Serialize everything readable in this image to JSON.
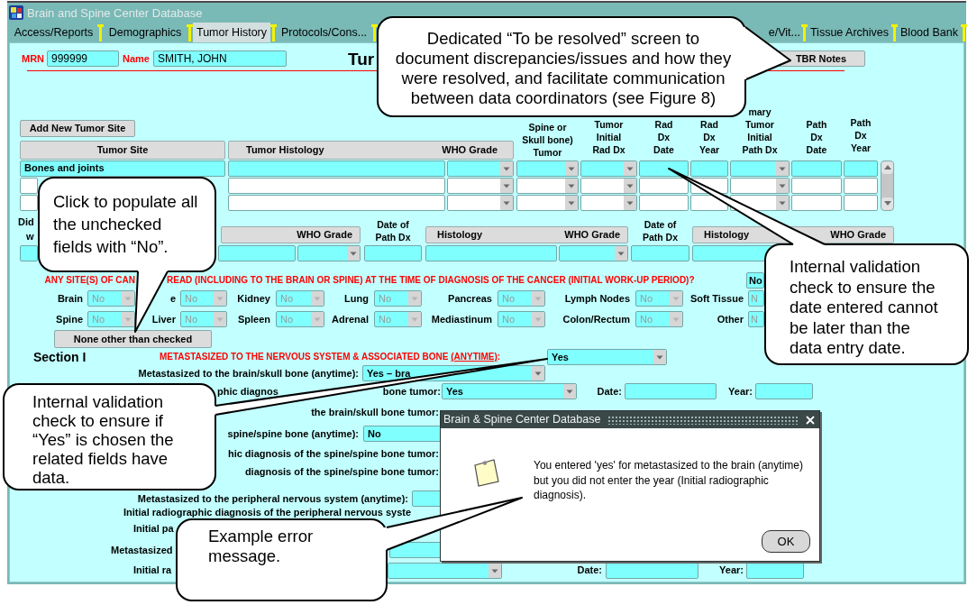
{
  "window": {
    "title": "Brain and Spine Center Database"
  },
  "tabs": [
    {
      "label": "Access/Reports",
      "selected": false
    },
    {
      "label": "Demographics",
      "selected": false
    },
    {
      "label": "Tumor History",
      "selected": true
    },
    {
      "label": "Protocols/Cons...",
      "selected": false
    },
    {
      "label": "e/Vit...",
      "selected": false
    },
    {
      "label": "Tissue Archives",
      "selected": false
    },
    {
      "label": "Blood Bank",
      "selected": false
    }
  ],
  "patient": {
    "mrn_label": "MRN",
    "mrn": "999999",
    "name_label": "Name",
    "name": "SMITH, JOHN"
  },
  "page_title": "Tur",
  "tbr_button": "TBR Notes",
  "tumor_table": {
    "add_button": "Add New Tumor Site",
    "header_boxes": [
      [
        "Tumor Site"
      ],
      [
        "Tumor Histology",
        "WHO Grade"
      ]
    ],
    "column_headers": [
      "Spine or\nSkull bone)\nTumor",
      "Tumor\nInitial\nRad Dx",
      "Rad\nDx\nDate",
      "Rad\nDx\nYear",
      "mary\nTumor\nInitial\nPath Dx",
      "Path\nDx\nDate",
      "Path\nDx\nYear"
    ],
    "columns": [
      {
        "kind": "text"
      },
      {
        "kind": "text"
      },
      {
        "kind": "select"
      },
      {
        "kind": "select"
      },
      {
        "kind": "select"
      },
      {
        "kind": "text"
      },
      {
        "kind": "text"
      },
      {
        "kind": "select"
      },
      {
        "kind": "text"
      },
      {
        "kind": "text"
      }
    ],
    "rows": [
      {
        "selected": true,
        "tumor_site": "Bones and joints"
      },
      {
        "selected": false
      },
      {
        "selected": false
      }
    ]
  },
  "pathology": {
    "label_fragments": [
      "Did",
      "w"
    ],
    "header_groups": [
      {
        "labels": [
          "WHO Grade"
        ],
        "date_label": "Date of\nPath Dx"
      },
      {
        "labels": [
          "Histology",
          "WHO Grade"
        ],
        "date_label": "Date of\nPath Dx"
      },
      {
        "labels": [
          "Histology",
          "WHO Grade"
        ]
      }
    ],
    "fields": [
      {
        "kind": "text"
      },
      {
        "kind": "text"
      },
      {
        "kind": "select"
      },
      {
        "kind": "text"
      },
      {
        "kind": "text"
      },
      {
        "kind": "select"
      },
      {
        "kind": "text"
      },
      {
        "kind": "text"
      }
    ]
  },
  "spread_question": {
    "parts": [
      "ANY SITE(S) OF CAN",
      "READ (INCLUDING TO THE BRAIN OR SPINE) AT THE TIME OF DIAGNOSIS OF THE CANCER (INITIAL WORK-UP PERIOD)?"
    ],
    "answer": "No"
  },
  "sites": [
    [
      {
        "label": "Brain",
        "value": "No",
        "disabled": true
      },
      {
        "label": "e",
        "value": "No",
        "disabled": true
      },
      {
        "label": "Kidney",
        "value": "No",
        "disabled": true
      },
      {
        "label": "Lung",
        "value": "No",
        "disabled": true
      },
      {
        "label": "Pancreas",
        "value": "No",
        "disabled": true
      },
      {
        "label": "Lymph Nodes",
        "value": "No",
        "disabled": true
      },
      {
        "label": "Soft Tissue",
        "value": "N",
        "disabled": true
      }
    ],
    [
      {
        "label": "Spine",
        "value": "No",
        "disabled": true
      },
      {
        "label": "Liver",
        "value": "No",
        "disabled": true
      },
      {
        "label": "Spleen",
        "value": "No",
        "disabled": true
      },
      {
        "label": "Adrenal",
        "value": "No",
        "disabled": true
      },
      {
        "label": "Mediastinum",
        "value": "No",
        "disabled": true
      },
      {
        "label": "Colon/Rectum",
        "value": "No",
        "disabled": true
      },
      {
        "label": "Other",
        "value": "N",
        "disabled": true
      }
    ]
  ],
  "none_button": "None other than checked",
  "section_1": {
    "label": "Section I",
    "heading": {
      "before": "METASTASIZED TO THE NERVOUS SYSTEM & ASSOCIATED BONE ",
      "underlined": "(ANYTIME)",
      "after": ":"
    },
    "answer": "Yes",
    "rows": [
      {
        "label_parts": [
          "Metastasized to the brain/skull bone (anytime):"
        ],
        "field": {
          "kind": "select",
          "value": "Yes – bra"
        }
      },
      {
        "label_parts": [
          "phic diagnos",
          "bone tumor:"
        ],
        "field": {
          "kind": "select",
          "value": "Yes"
        },
        "date_label": "Date:",
        "year_label": "Year:"
      },
      {
        "label_parts": [
          "the brain/skull bone tumor:"
        ]
      },
      {
        "label_parts": [
          "spine/spine bone (anytime):"
        ],
        "field": {
          "kind": "select",
          "value": "No"
        }
      },
      {
        "label_parts": [
          "hic diagnosis of the spine/spine bone tumor:"
        ]
      },
      {
        "label_parts": [
          "diagnosis of the spine/spine bone tumor:"
        ]
      },
      {
        "label_parts": [
          "Metastasized to the peripheral nervous system (anytime):"
        ],
        "field": {
          "kind": "text"
        }
      },
      {
        "label_parts": [
          "Initial radiographic diagnosis of the peripheral nervous syste"
        ]
      },
      {
        "label_parts": [
          "Initial pa"
        ]
      },
      {
        "label_parts": [
          "Metastasized"
        ],
        "field": {
          "kind": "text"
        }
      },
      {
        "label_parts": [
          "Initial ra"
        ],
        "field": {
          "kind": "select"
        },
        "date_label": "Date:",
        "year_label": "Year:"
      }
    ]
  },
  "dialog": {
    "title": "Brain & Spine Center Database",
    "message": "You entered 'yes' for metastasized to the brain (anytime) but you did not enter the year (Initial radiographic diagnosis).",
    "ok_button": "OK"
  },
  "callouts": [
    {
      "text": "Dedicated “To be resolved” screen to document discrepancies/issues and how they were resolved, and facilitate communication between data coordinators (see Figure 8)"
    },
    {
      "text": "Click to populate all the unchecked\nfields with “No”."
    },
    {
      "text": "Internal validation check to ensure the date entered cannot be later than the data entry date."
    },
    {
      "text": "Internal validation check to ensure if “Yes” is chosen the related fields have data."
    },
    {
      "text": "Example error message."
    }
  ]
}
